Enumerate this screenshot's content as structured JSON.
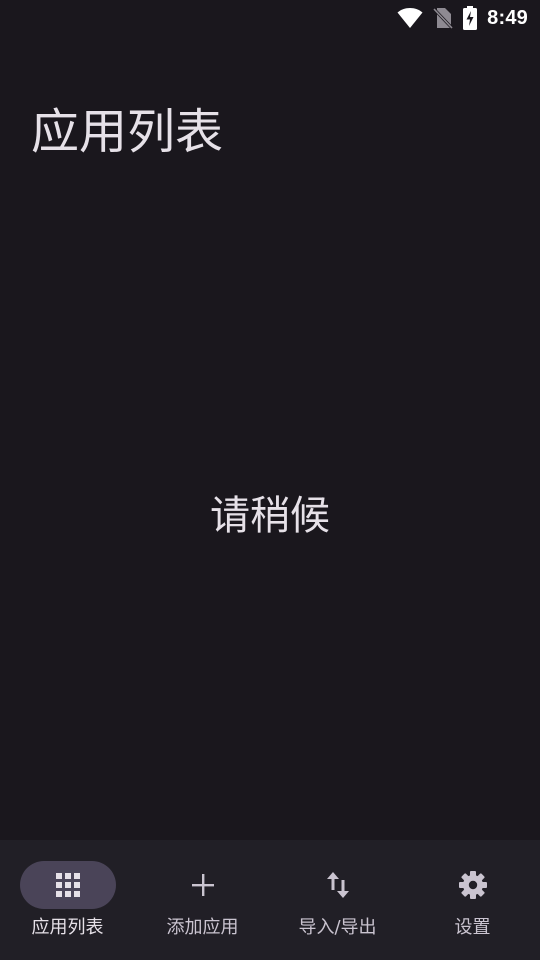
{
  "status_bar": {
    "time": "8:49",
    "icons": [
      "wifi-icon",
      "no-sim-icon",
      "battery-charging-icon"
    ]
  },
  "page": {
    "title": "应用列表",
    "loading_text": "请稍候"
  },
  "bottom_nav": {
    "items": [
      {
        "label": "应用列表",
        "icon": "grid-icon",
        "active": true
      },
      {
        "label": "添加应用",
        "icon": "plus-icon",
        "active": false
      },
      {
        "label": "导入/导出",
        "icon": "swap-vertical-icon",
        "active": false
      },
      {
        "label": "设置",
        "icon": "gear-icon",
        "active": false
      }
    ]
  },
  "colors": {
    "background": "#1a171d",
    "nav_background": "#211f26",
    "active_pill": "#4a4458",
    "text": "#e6e1e8",
    "secondary_text": "#cac4d0"
  }
}
